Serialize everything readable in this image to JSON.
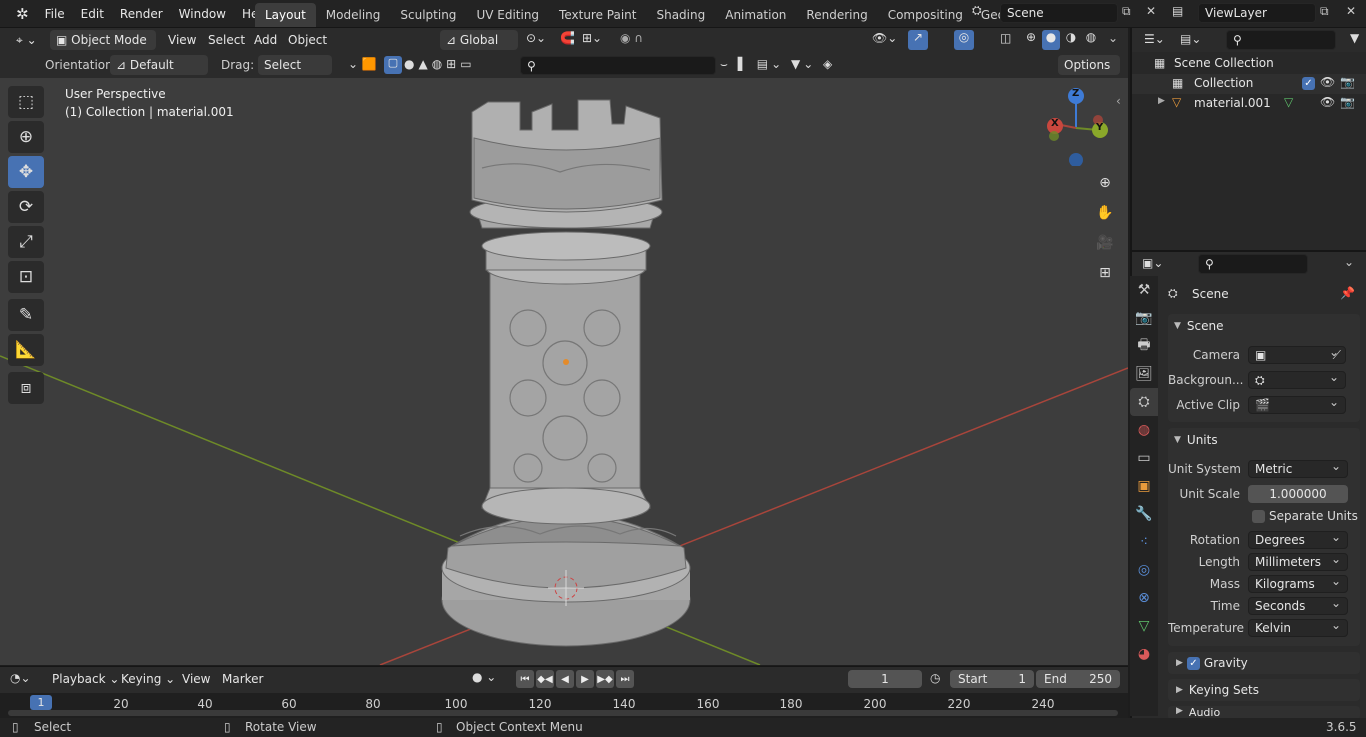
{
  "menu": {
    "file": "File",
    "edit": "Edit",
    "render": "Render",
    "window": "Window",
    "help": "Help"
  },
  "workspaces": [
    "Layout",
    "Modeling",
    "Sculpting",
    "UV Editing",
    "Texture Paint",
    "Shading",
    "Animation",
    "Rendering",
    "Compositing",
    "Geometry Noc"
  ],
  "scene_name": "Scene",
  "view_layer": "ViewLayer",
  "viewport_header": {
    "mode": "Object Mode",
    "view": "View",
    "select": "Select",
    "add": "Add",
    "object": "Object",
    "transform": "Global"
  },
  "tool_settings": {
    "orientation_label": "Orientation:",
    "orientation_value": "Default",
    "drag_label": "Drag:",
    "drag_value": "Select Box",
    "options": "Options"
  },
  "viewport": {
    "perspective": "User Perspective",
    "context": "(1) Collection | material.001",
    "gizmo_z": "Z",
    "gizmo_y": "Y",
    "gizmo_x": "X"
  },
  "outliner": {
    "scene_collection": "Scene Collection",
    "collection": "Collection",
    "object": "material.001"
  },
  "properties": {
    "context": "Scene",
    "scene_panel": "Scene",
    "camera_label": "Camera",
    "background_label": "Backgroun...",
    "active_clip_label": "Active Clip",
    "units_panel": "Units",
    "unit_system_label": "Unit System",
    "unit_system": "Metric",
    "unit_scale_label": "Unit Scale",
    "unit_scale": "1.000000",
    "separate_units": "Separate Units",
    "rotation_label": "Rotation",
    "rotation": "Degrees",
    "length_label": "Length",
    "length": "Millimeters",
    "mass_label": "Mass",
    "mass": "Kilograms",
    "time_label": "Time",
    "time": "Seconds",
    "temperature_label": "Temperature",
    "temperature": "Kelvin",
    "gravity": "Gravity",
    "keying_sets": "Keying Sets",
    "audio": "Audio"
  },
  "timeline": {
    "playback": "Playback",
    "keying": "Keying",
    "view": "View",
    "marker": "Marker",
    "current_frame": "1",
    "start_label": "Start",
    "start": "1",
    "end_label": "End",
    "end": "250",
    "ticks": [
      "1",
      "20",
      "40",
      "60",
      "80",
      "100",
      "120",
      "140",
      "160",
      "180",
      "200",
      "220",
      "240"
    ]
  },
  "status": {
    "select": "Select",
    "rotate": "Rotate View",
    "context_menu": "Object Context Menu",
    "version": "3.6.5"
  },
  "colors": {
    "accent": "#4772b3",
    "x_axis": "#a8453b",
    "y_axis": "#6e8a28",
    "z_axis": "#3e7bd6"
  }
}
